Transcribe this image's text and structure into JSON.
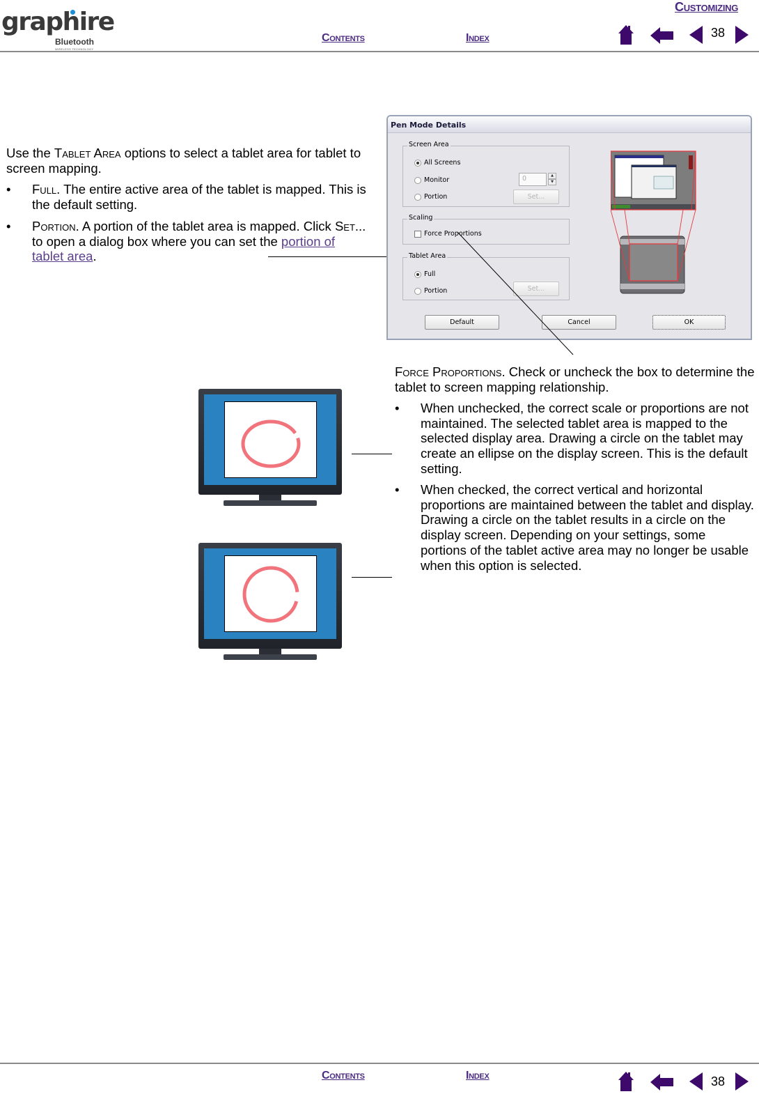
{
  "header": {
    "logo": {
      "word": "graphire",
      "sub": "Bluetooth",
      "tagline": "WIRELESS TECHNOLOGY"
    },
    "section_link": "Customizing",
    "contents_link": "Contents",
    "index_link": "Index",
    "page_number": "38",
    "icons": [
      "home-icon",
      "back-arrow-icon",
      "previous-page-icon",
      "next-page-icon"
    ]
  },
  "footer": {
    "contents_link": "Contents",
    "index_link": "Index",
    "page_number": "38"
  },
  "colors": {
    "link": "#4b2a82",
    "text_link": "#5b3f8c",
    "screen_blue": "#2a82c0",
    "circle_red": "#ef5a64"
  },
  "tablet_area_text": {
    "intro_pre": "Use the ",
    "intro_sc": "Tablet Area",
    "intro_post": " options to select a tablet area for tablet to screen mapping.",
    "bullets": [
      {
        "term": "Full",
        "text": ".  The entire active area of the tablet is mapped. This is the default setting."
      },
      {
        "term": "Portion",
        "text_a": ".  A portion of the tablet area is mapped. Click ",
        "set_sc": "Set",
        "text_b": "... to open a dialog box where you can set the ",
        "link": "portion of tablet area",
        "text_c": "."
      }
    ]
  },
  "dialog": {
    "title": "Pen Mode Details",
    "screen_area": {
      "legend": "Screen Area",
      "options": [
        "All Screens",
        "Monitor",
        "Portion"
      ],
      "selected": "All Screens",
      "monitor_value": "0",
      "set_button": "Set..."
    },
    "scaling": {
      "legend": "Scaling",
      "checkbox_label": "Force Proportions",
      "checked": false
    },
    "tablet_area": {
      "legend": "Tablet Area",
      "options": [
        "Full",
        "Portion"
      ],
      "selected": "Full",
      "set_button": "Set..."
    },
    "buttons": {
      "default": "Default",
      "cancel": "Cancel",
      "ok": "OK"
    }
  },
  "force_proportions_text": {
    "intro_sc": "Force Proportions",
    "intro_post": ".  Check or uncheck the box to determine the tablet to screen mapping relationship.",
    "bullets": [
      "When unchecked, the correct scale or proportions are not maintained.  The selected tablet area is mapped to the selected display area.  Drawing a circle on the tablet may create an ellipse on the display screen.  This is the default setting.",
      "When checked, the correct vertical and horizontal proportions are maintained between the tablet and display.  Drawing a circle on the tablet results in a circle on the display screen.  Depending on your settings, some portions of the tablet active area may no longer be usable when this option is selected."
    ],
    "bullet_char": "•"
  },
  "illustrations": [
    {
      "name": "monitor-ellipse",
      "shape": "ellipse"
    },
    {
      "name": "monitor-circle",
      "shape": "circle"
    }
  ]
}
